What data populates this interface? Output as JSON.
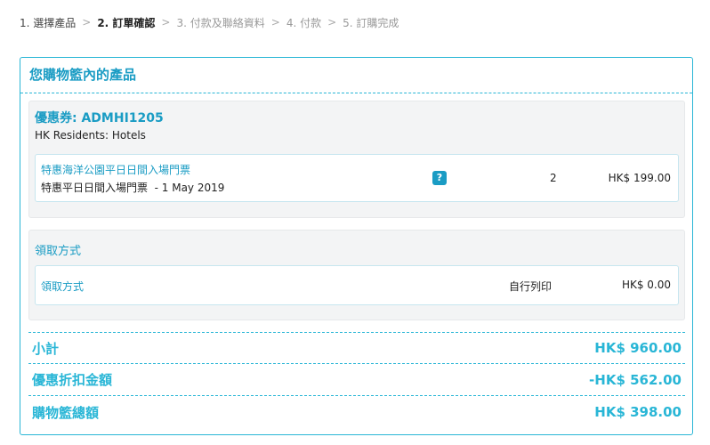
{
  "steps": [
    {
      "label": "1. 選擇產品",
      "state": "done"
    },
    {
      "label": "2. 訂單確認",
      "state": "active"
    },
    {
      "label": "3. 付款及聯絡資料",
      "state": "pending"
    },
    {
      "label": "4. 付款",
      "state": "pending"
    },
    {
      "label": "5. 訂購完成",
      "state": "pending"
    }
  ],
  "separator": ">",
  "cart": {
    "title": "您購物籃內的產品",
    "coupon": {
      "code": "優惠券: ADMHI1205",
      "subtitle": "HK Residents: Hotels",
      "item": {
        "name": "特惠海洋公園平日日間入場門票",
        "date": "特惠平日日間入場門票  - 1 May 2019",
        "help_icon": "question-icon",
        "help_glyph": "?",
        "qty": "2",
        "price": "HK$ 199.00"
      }
    },
    "pickup": {
      "title": "領取方式",
      "label": "領取方式",
      "method": "自行列印",
      "price": "HK$ 0.00"
    },
    "totals": {
      "subtotal_label": "小計",
      "subtotal_value": "HK$ 960.00",
      "discount_label": "優惠折扣金額",
      "discount_value": "-HK$ 562.00",
      "total_label": "購物籃總額",
      "total_value": "HK$ 398.00"
    }
  },
  "colors": {
    "accent": "#29b6d6",
    "accent_text": "#1a9cc4",
    "panel_bg": "#f3f4f5"
  }
}
